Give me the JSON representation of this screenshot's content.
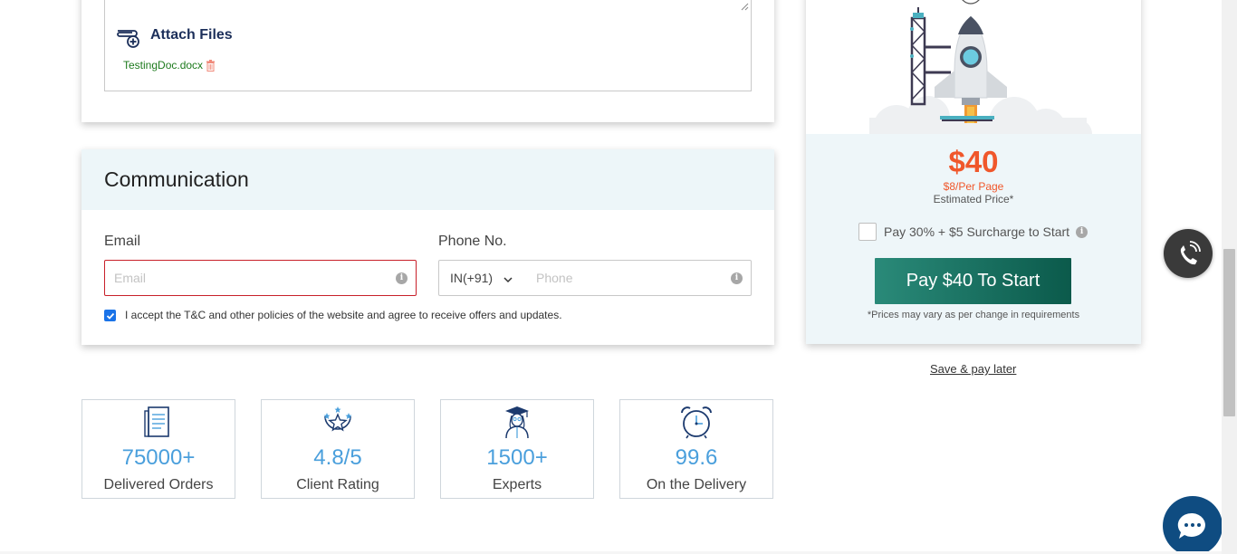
{
  "attach": {
    "label": "Attach Files",
    "file_name": "TestingDoc.docx"
  },
  "communication": {
    "title": "Communication",
    "email_label": "Email",
    "email_placeholder": "Email",
    "phone_label": "Phone No.",
    "country_code": "IN(+91)",
    "phone_placeholder": "Phone",
    "terms_text": "I accept the T&C and other policies of the website and agree to receive offers and updates.",
    "terms_checked": true
  },
  "stats": [
    {
      "icon": "document-icon",
      "value": "75000+",
      "label": "Delivered Orders"
    },
    {
      "icon": "star-rating-icon",
      "value": "4.8/5",
      "label": "Client Rating"
    },
    {
      "icon": "graduate-icon",
      "value": "1500+",
      "label": "Experts"
    },
    {
      "icon": "alarm-clock-icon",
      "value": "99.6",
      "label": "On the Delivery"
    }
  ],
  "pricing": {
    "price": "$40",
    "per_page": "$8/Per Page",
    "estimated_label": "Estimated Price*",
    "surcharge_text": "Pay 30% + $5 Surcharge to Start",
    "pay_button": "Pay $40 To Start",
    "disclaimer": "*Prices may vary as per change in requirements",
    "save_later": "Save & pay later"
  },
  "colors": {
    "accent_orange": "#f0572b",
    "stat_blue": "#4a9fdc",
    "pay_button_start": "#2a8a79",
    "pay_button_end": "#0b5a4b",
    "error_border": "#c8202a"
  }
}
